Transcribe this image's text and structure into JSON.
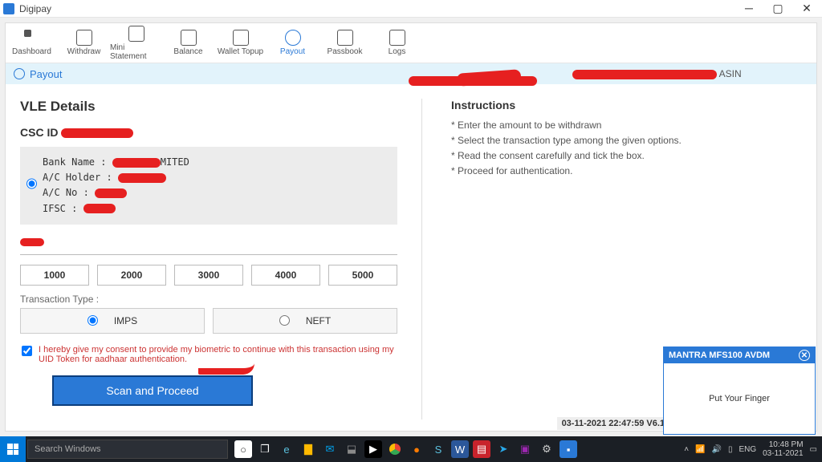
{
  "window": {
    "title": "Digipay"
  },
  "nav": [
    {
      "label": "Dashboard"
    },
    {
      "label": "Withdraw"
    },
    {
      "label": "Mini Statement"
    },
    {
      "label": "Balance"
    },
    {
      "label": "Wallet Topup"
    },
    {
      "label": "Payout"
    },
    {
      "label": "Passbook"
    },
    {
      "label": "Logs"
    }
  ],
  "crumb": {
    "title": "Payout",
    "user_suffix": "ASIN"
  },
  "vle": {
    "heading": "VLE Details",
    "csc_label": "CSC ID",
    "bank": {
      "bank_name_label": "Bank Name :",
      "bank_name_suffix": "MITED",
      "ac_holder_label": "A/C Holder :",
      "ac_no_label": "A/C No :",
      "ifsc_label": "IFSC :"
    },
    "amounts": [
      "1000",
      "2000",
      "3000",
      "4000",
      "5000"
    ],
    "tx_label": "Transaction Type :",
    "tx_options": [
      "IMPS",
      "NEFT"
    ],
    "consent": "I hereby give my consent to provide my biometric to continue with this transaction using my UID Token for aadhaar authentication.",
    "scan_label": "Scan and Proceed"
  },
  "instructions": {
    "heading": "Instructions",
    "items": [
      "Enter the amount to be withdrawn",
      "Select the transaction type among the given options.",
      "Read the consent carefully and tick the box.",
      "Proceed for authentication."
    ]
  },
  "version": "03-11-2021 22:47:59  V6.1",
  "mantra": {
    "title": "MANTRA MFS100 AVDM",
    "body": "Put Your Finger"
  },
  "taskbar": {
    "search_placeholder": "Search Windows",
    "lang": "ENG",
    "time": "10:48 PM",
    "date": "03-11-2021"
  }
}
